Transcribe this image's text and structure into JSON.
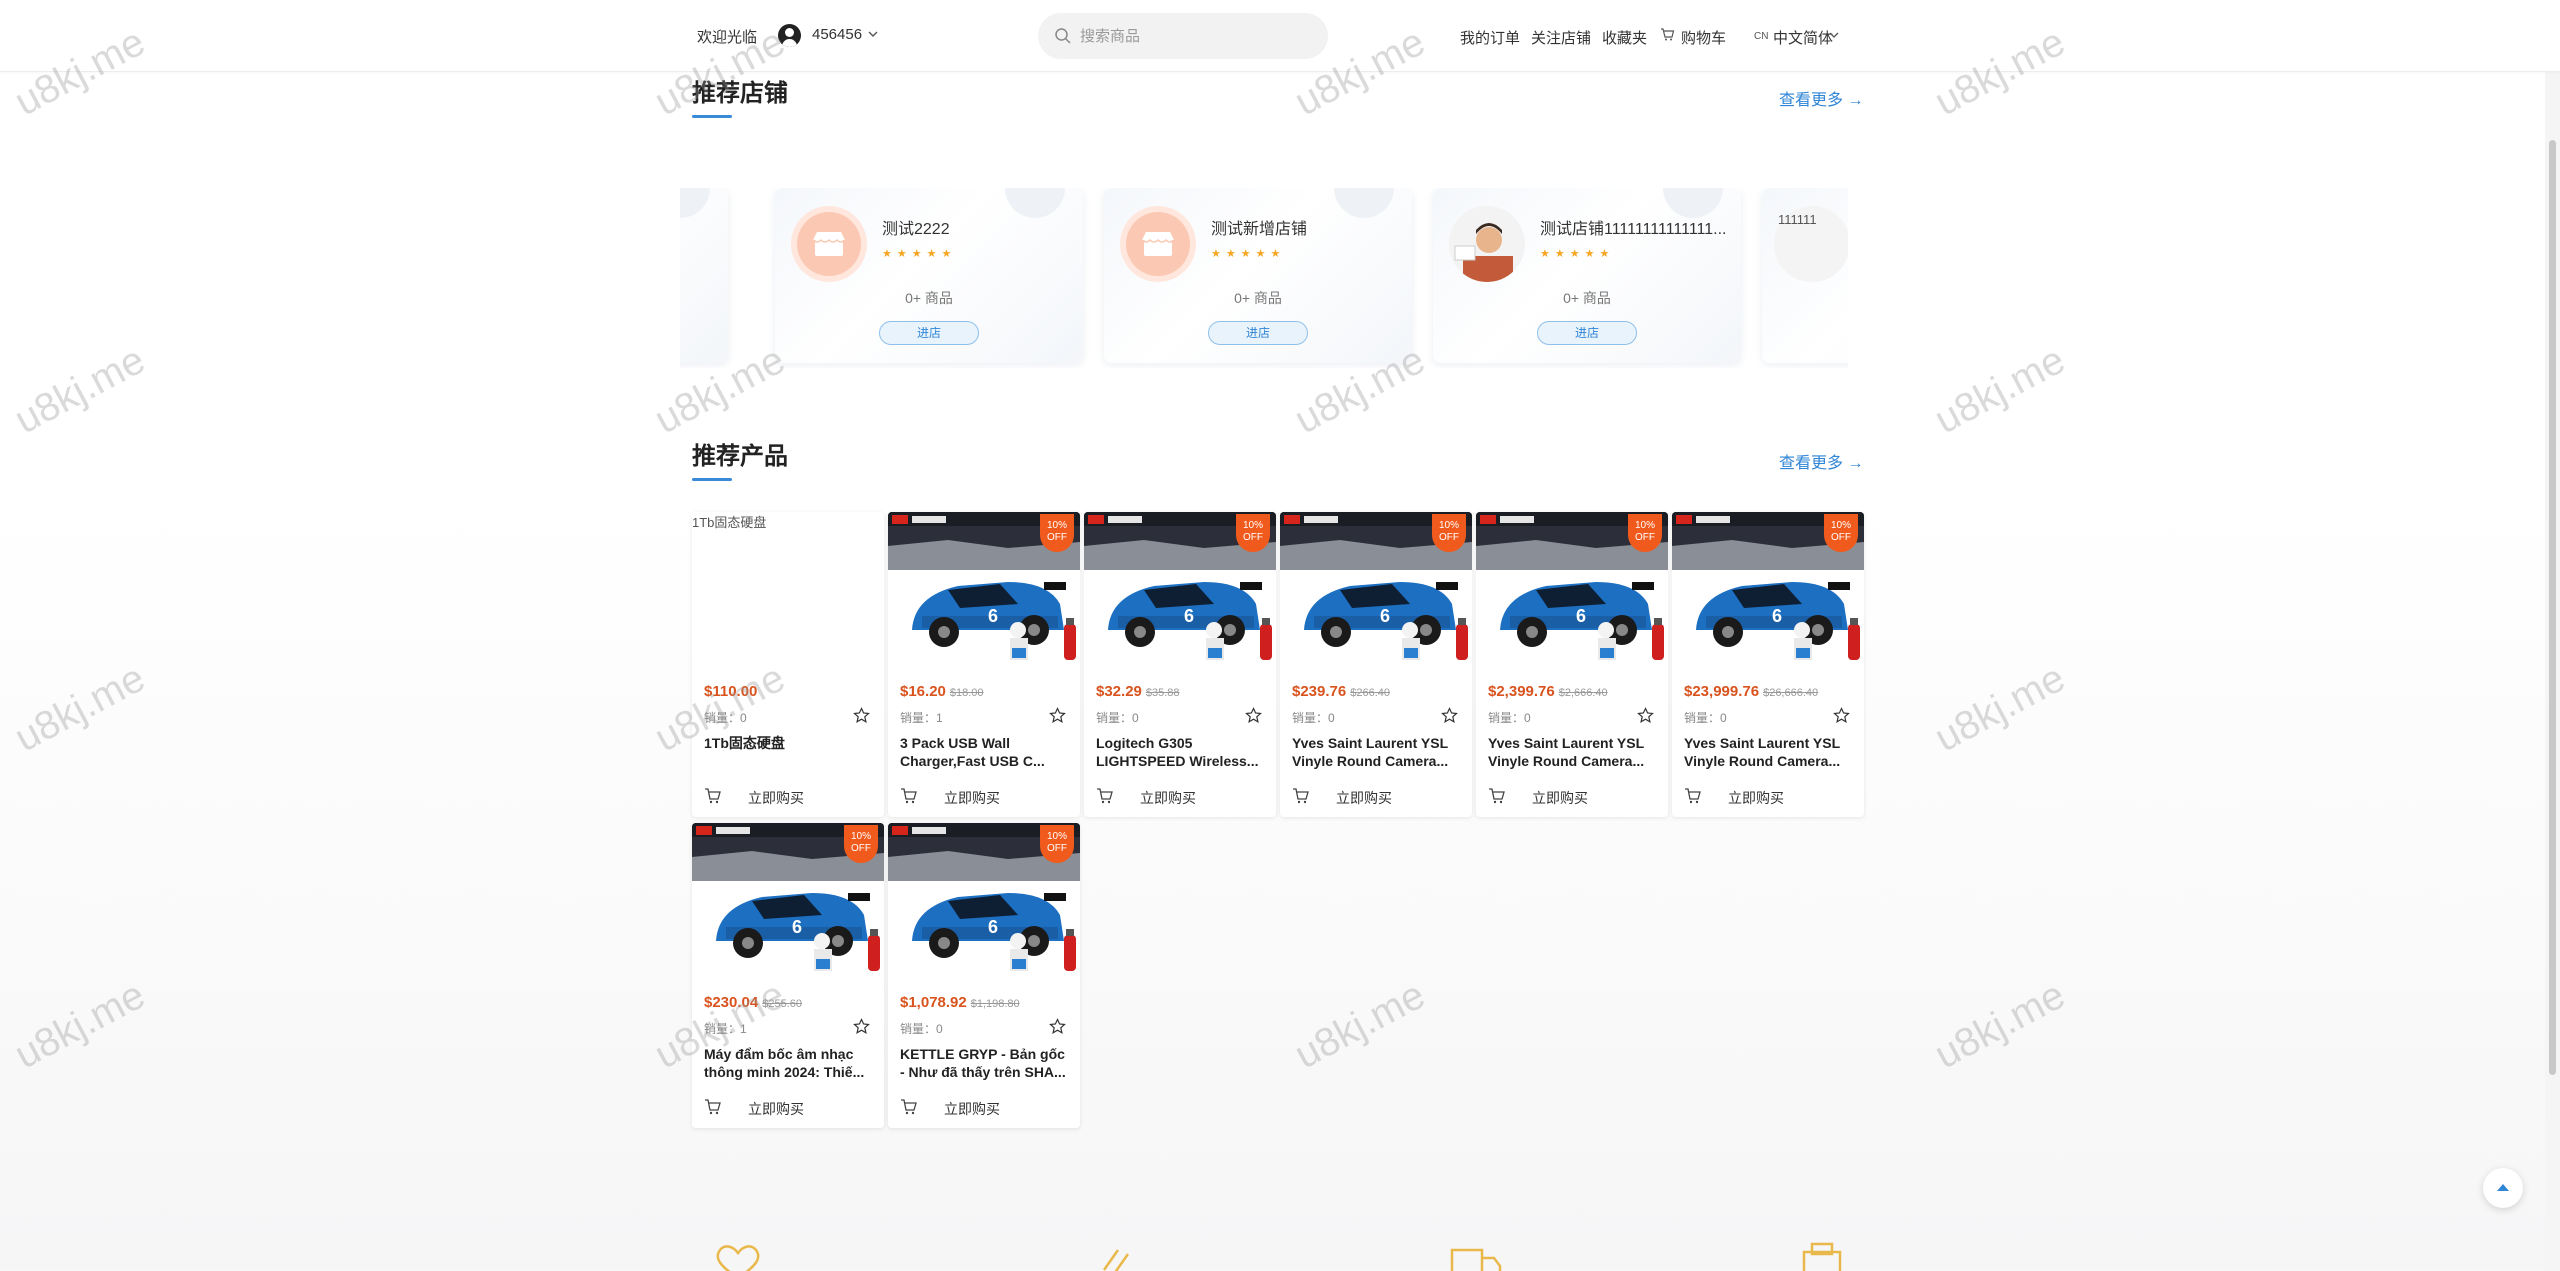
{
  "header": {
    "welcome": "欢迎光临",
    "username": "456456",
    "search_placeholder": "搜索商品",
    "nav": {
      "orders": "我的订单",
      "followed_shops": "关注店铺",
      "favorites": "收藏夹",
      "cart": "购物车"
    },
    "lang_code": "CN",
    "lang_name": "中文简体"
  },
  "shops_section": {
    "title": "推荐店铺",
    "see_more": "查看更多 →",
    "shops": [
      {
        "name": "测试2222",
        "stars": "★★★★★",
        "count": "0+ 商品",
        "enter": "进店"
      },
      {
        "name": "测试新增店铺",
        "stars": "★★★★★",
        "count": "0+ 商品",
        "enter": "进店"
      },
      {
        "name": "测试店铺11111111111111...",
        "stars": "★★★★★",
        "count": "0+ 商品",
        "enter": "进店"
      }
    ],
    "partial_shop_alt": "111111"
  },
  "products_section": {
    "title": "推荐产品",
    "see_more": "查看更多 →",
    "products": [
      {
        "img_alt": "1Tb固态硬盘",
        "price": "$110.00",
        "orig": "",
        "sales": "销量：0",
        "name": "1Tb固态硬盘",
        "buy": "立即购买",
        "badge": ""
      },
      {
        "price": "$16.20",
        "orig": "$18.00",
        "sales": "销量：1",
        "name": "3 Pack USB Wall Charger,Fast USB C...",
        "buy": "立即购买",
        "badge": "10% OFF"
      },
      {
        "price": "$32.29",
        "orig": "$35.88",
        "sales": "销量：0",
        "name": "Logitech G305 LIGHTSPEED Wireless...",
        "buy": "立即购买",
        "badge": "10% OFF"
      },
      {
        "price": "$239.76",
        "orig": "$266.40",
        "sales": "销量：0",
        "name": "Yves Saint Laurent YSL Vinyle Round Camera...",
        "buy": "立即购买",
        "badge": "10% OFF"
      },
      {
        "price": "$2,399.76",
        "orig": "$2,666.40",
        "sales": "销量：0",
        "name": "Yves Saint Laurent YSL Vinyle Round Camera...",
        "buy": "立即购买",
        "badge": "10% OFF"
      },
      {
        "price": "$23,999.76",
        "orig": "$26,666.40",
        "sales": "销量：0",
        "name": "Yves Saint Laurent YSL Vinyle Round Camera...",
        "buy": "立即购买",
        "badge": "10% OFF"
      },
      {
        "price": "$230.04",
        "orig": "$255.60",
        "sales": "销量：1",
        "name": "Máy đẩm bốc âm nhạc thông minh 2024: Thiế...",
        "buy": "立即购买",
        "badge": "10% OFF"
      },
      {
        "price": "$1,078.92",
        "orig": "$1,198.80",
        "sales": "销量：0",
        "name": "KETTLE GRYP - Bản gốc - Như đã thấy trên SHA...",
        "buy": "立即购买",
        "badge": "10% OFF"
      }
    ]
  },
  "watermark": "u8kj.me",
  "colors": {
    "accent": "#2f85d6",
    "price": "#d9531e",
    "badge": "#f05a1c",
    "star": "#f5a623",
    "footer_icon": "#e9b84a"
  }
}
